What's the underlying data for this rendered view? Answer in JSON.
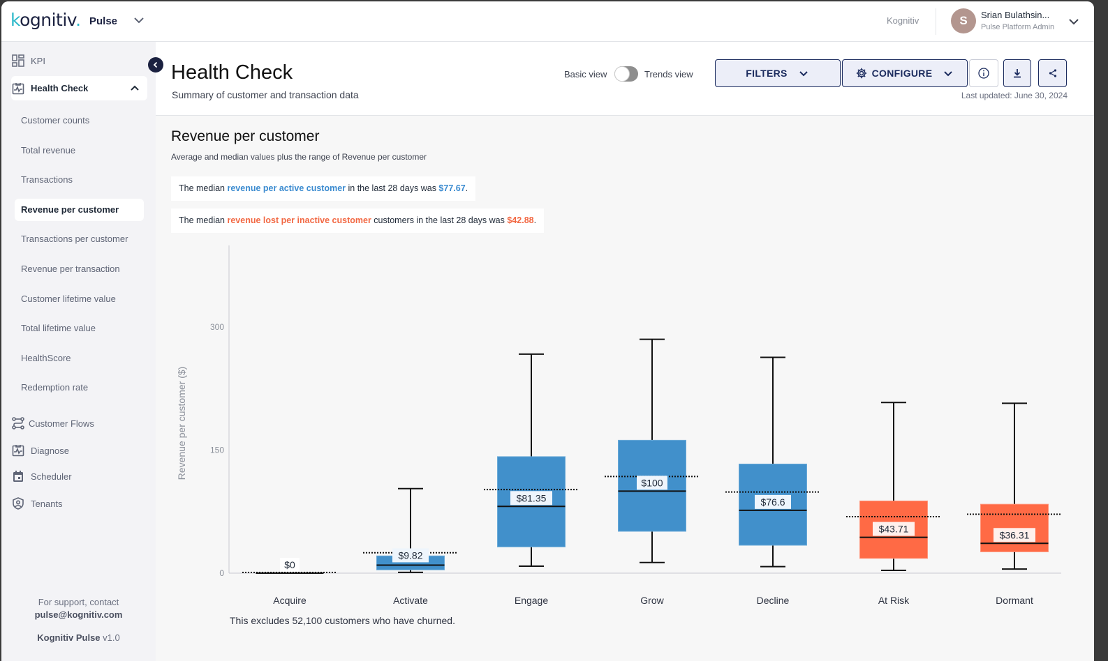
{
  "topbar": {
    "logo": "kognitiv",
    "app_name": "Pulse",
    "org_name": "Kognitiv",
    "user": {
      "initial": "S",
      "name": "Srian Bulathsin...",
      "role": "Pulse Platform Admin"
    }
  },
  "sidebar": {
    "kpi_label": "KPI",
    "health_check_label": "Health Check",
    "sub_items": [
      {
        "label": "Customer counts",
        "active": false
      },
      {
        "label": "Total revenue",
        "active": false
      },
      {
        "label": "Transactions",
        "active": false
      },
      {
        "label": "Revenue per customer",
        "active": true
      },
      {
        "label": "Transactions per customer",
        "active": false
      },
      {
        "label": "Revenue per transaction",
        "active": false
      },
      {
        "label": "Customer lifetime value",
        "active": false
      },
      {
        "label": "Total lifetime value",
        "active": false
      },
      {
        "label": "HealthScore",
        "active": false
      },
      {
        "label": "Redemption rate",
        "active": false
      }
    ],
    "sections": [
      {
        "label": "Customer Flows",
        "icon": "flows-icon"
      },
      {
        "label": "Diagnose",
        "icon": "diagnose-icon"
      },
      {
        "label": "Scheduler",
        "icon": "calendar-icon"
      },
      {
        "label": "Tenants",
        "icon": "shield-user-icon"
      }
    ],
    "support_text": "For support, contact",
    "support_email": "pulse@kognitiv.com",
    "product_name": "Kognitiv Pulse",
    "version": "v1.0"
  },
  "header": {
    "title": "Health Check",
    "subtitle": "Summary of customer and transaction data",
    "toggle_left": "Basic view",
    "toggle_right": "Trends view",
    "toggle_trends_on": false,
    "filters_label": "FILTERS",
    "configure_label": "CONFIGURE",
    "last_updated": "Last updated: June 30, 2024"
  },
  "section": {
    "title": "Revenue per customer",
    "subtitle": "Average and median values plus the range of Revenue per customer",
    "insight1": {
      "pre": "The median ",
      "highlight": "revenue per active customer",
      "mid": " in the last 28 days was ",
      "value": "$77.67",
      "post": "."
    },
    "insight2": {
      "pre": "The median ",
      "highlight": "revenue lost per inactive customer",
      "mid": " customers in the last 28 days was ",
      "value": "$42.88",
      "post": "."
    },
    "footnote": "This excludes 52,100 customers who have churned."
  },
  "colors": {
    "active": "#4190cb",
    "inactive": "#ff6a45",
    "accent_blue": "#3b8bd0",
    "accent_red": "#f26843",
    "navy": "#1b2b5e"
  },
  "chart_data": {
    "type": "boxplot",
    "title": "",
    "xlabel": "",
    "ylabel": "Revenue per customer ($)",
    "ylim": [
      0,
      400
    ],
    "yticks": [
      0,
      150,
      300
    ],
    "grid": false,
    "legend": "none",
    "categories": [
      "Acquire",
      "Activate",
      "Engage",
      "Grow",
      "Decline",
      "At Risk",
      "Dormant"
    ],
    "series": [
      {
        "name": "Acquire",
        "group": "active",
        "min": 0,
        "q1": 0,
        "median": 0,
        "q3": 0,
        "max": 0,
        "mean": 0,
        "label": "$0"
      },
      {
        "name": "Activate",
        "group": "active",
        "min": 1,
        "q1": 4,
        "median": 9.82,
        "q3": 21,
        "max": 103,
        "mean": 24,
        "label": "$9.82"
      },
      {
        "name": "Engage",
        "group": "active",
        "min": 8.5,
        "q1": 32,
        "median": 81.35,
        "q3": 142,
        "max": 267,
        "mean": 101,
        "label": "$81.35"
      },
      {
        "name": "Grow",
        "group": "active",
        "min": 13,
        "q1": 51,
        "median": 100,
        "q3": 162,
        "max": 285,
        "mean": 117,
        "label": "$100"
      },
      {
        "name": "Decline",
        "group": "active",
        "min": 8,
        "q1": 34,
        "median": 76.6,
        "q3": 133,
        "max": 263,
        "mean": 98,
        "label": "$76.6"
      },
      {
        "name": "At Risk",
        "group": "inactive",
        "min": 3.4,
        "q1": 18,
        "median": 43.71,
        "q3": 88,
        "max": 208,
        "mean": 68,
        "label": "$43.71"
      },
      {
        "name": "Dormant",
        "group": "inactive",
        "min": 5,
        "q1": 26,
        "median": 36.31,
        "q3": 84,
        "max": 207,
        "mean": 71,
        "label": "$36.31"
      }
    ]
  }
}
